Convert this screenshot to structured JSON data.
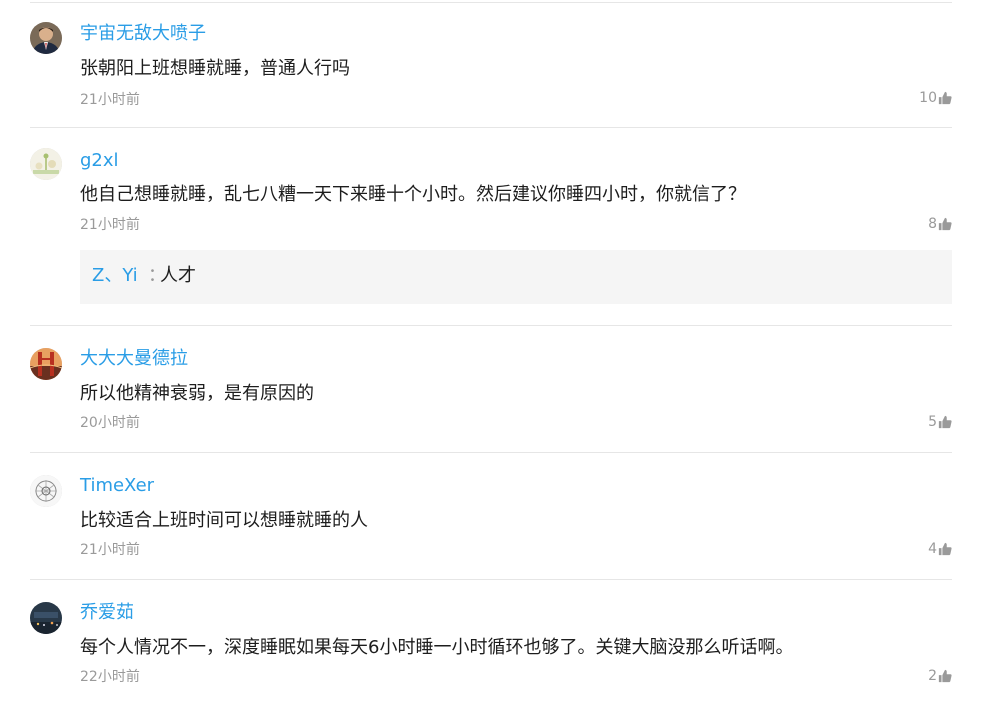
{
  "comments": [
    {
      "user": "宇宙无敌大喷子",
      "avatar": "man-in-suit-avatar",
      "text": "张朝阳上班想睡就睡，普通人行吗",
      "time": "21小时前",
      "likes": "10"
    },
    {
      "user": "g2xl",
      "avatar": "cartoon-avatar",
      "text": "他自己想睡就睡，乱七八糟一天下来睡十个小时。然后建议你睡四小时，你就信了？",
      "time": "21小时前",
      "likes": "8",
      "reply": {
        "user": "Z、Yi",
        "colon": "：",
        "text": "人才"
      }
    },
    {
      "user": "大大大曼德拉",
      "avatar": "bridge-avatar",
      "text": "所以他精神衰弱，是有原因的",
      "time": "20小时前",
      "likes": "5"
    },
    {
      "user": "TimeXer",
      "avatar": "sketch-avatar",
      "text": "比较适合上班时间可以想睡就睡的人",
      "time": "21小时前",
      "likes": "4"
    },
    {
      "user": "乔爱茹",
      "avatar": "night-scene-avatar",
      "text": "每个人情况不一，深度睡眠如果每天6小时睡一小时循环也够了。关键大脑没那么听话啊。",
      "time": "22小时前",
      "likes": "2"
    }
  ],
  "colors": {
    "username": "#2a9de6",
    "text": "#1d1d1d",
    "meta": "#9a9a9a",
    "divider": "#e6e6e6",
    "reply_bg": "#f5f5f5"
  },
  "icons": {
    "like": "thumbs-up-icon"
  }
}
